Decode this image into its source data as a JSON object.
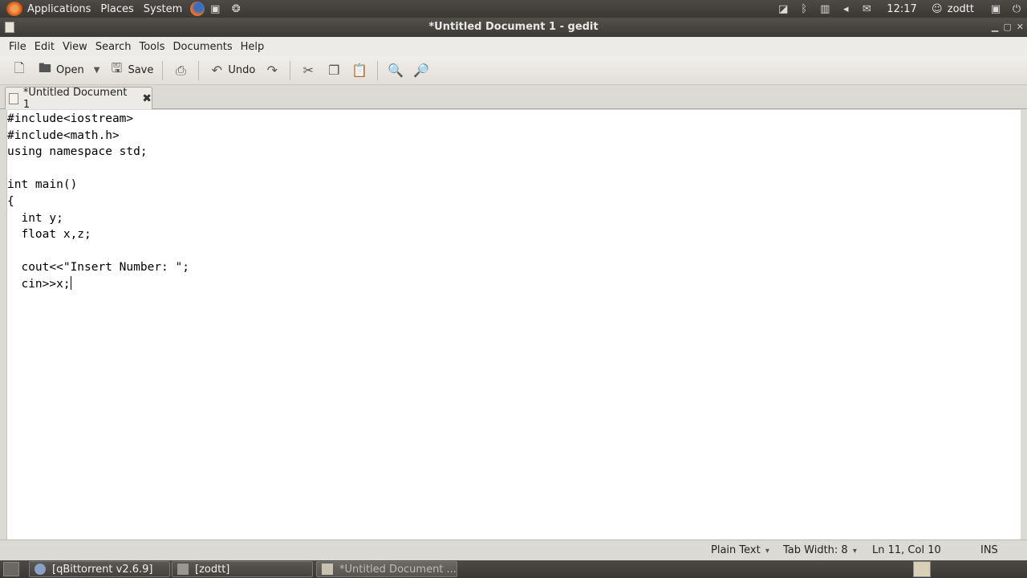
{
  "top_panel": {
    "menus": [
      "Applications",
      "Places",
      "System"
    ],
    "clock": "12:17",
    "user": "zodtt"
  },
  "window": {
    "title": "*Untitled Document 1 - gedit"
  },
  "menubar": [
    "File",
    "Edit",
    "View",
    "Search",
    "Tools",
    "Documents",
    "Help"
  ],
  "toolbar": {
    "open_label": "Open",
    "save_label": "Save",
    "undo_label": "Undo"
  },
  "tab": {
    "label": "*Untitled Document 1"
  },
  "editor": {
    "lines": [
      "#include<iostream>",
      "#include<math.h>",
      "using namespace std;",
      "",
      "int main()",
      "{",
      "  int y;",
      "  float x,z;",
      "",
      "  cout<<\"Insert Number: \";",
      "  cin>>x;"
    ]
  },
  "statusbar": {
    "language": "Plain Text",
    "tab_width": "Tab Width:  8",
    "position": "Ln 11, Col 10",
    "mode": "INS"
  },
  "taskbar": [
    {
      "label": "[qBittorrent v2.6.9]"
    },
    {
      "label": "[zodtt]"
    },
    {
      "label": "*Untitled Document ..."
    }
  ]
}
